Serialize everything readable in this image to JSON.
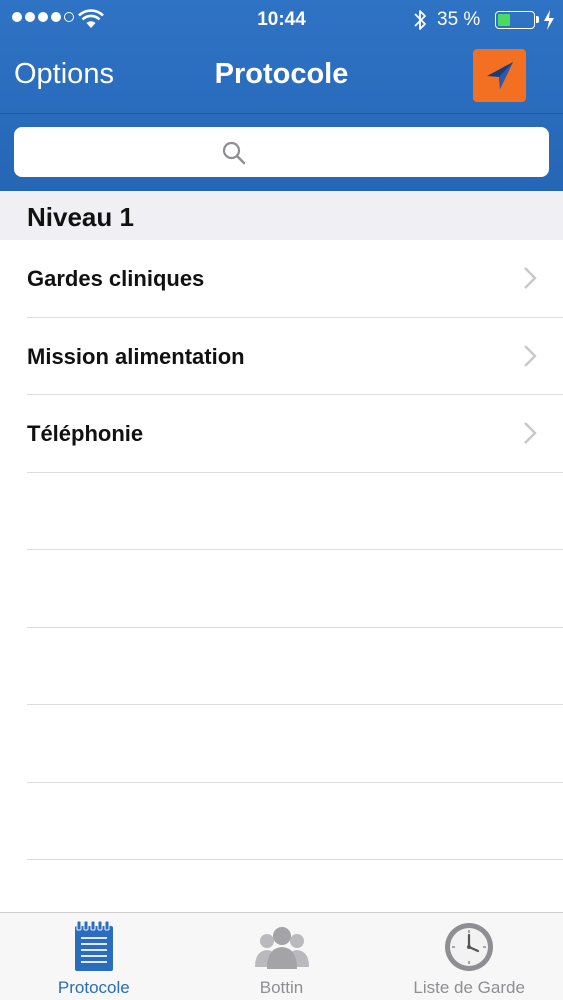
{
  "status_bar": {
    "time": "10:44",
    "battery_percent": "35 %",
    "battery_level": 0.35,
    "signal_dots": 4,
    "signal_max": 5
  },
  "nav": {
    "left_label": "Options",
    "title": "Protocole",
    "right_icon": "location-arrow-icon"
  },
  "search": {
    "placeholder": "",
    "value": ""
  },
  "section": {
    "title": "Niveau 1"
  },
  "list": {
    "items": [
      {
        "label": "Gardes cliniques"
      },
      {
        "label": "Mission alimentation"
      },
      {
        "label": "Téléphonie"
      }
    ]
  },
  "tabs": [
    {
      "label": "Protocole",
      "icon": "notepad-icon",
      "active": true
    },
    {
      "label": "Bottin",
      "icon": "people-icon",
      "active": false
    },
    {
      "label": "Liste de Garde",
      "icon": "clock-icon",
      "active": false
    }
  ],
  "colors": {
    "nav_blue": "#2a6cbd",
    "accent_orange": "#f36f21",
    "battery_green": "#4cd964",
    "section_gray": "#efeff4"
  }
}
